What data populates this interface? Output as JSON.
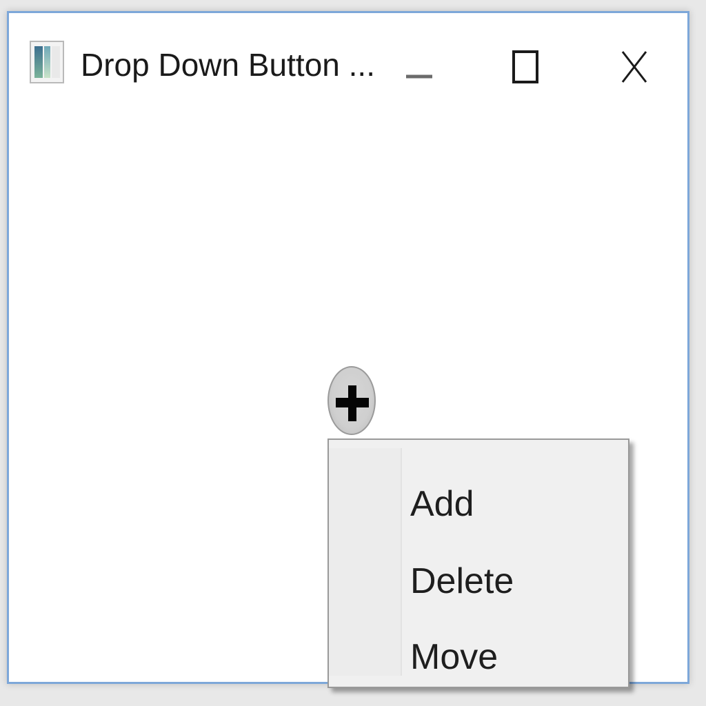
{
  "window": {
    "title": "Drop Down Button ..."
  },
  "icons": {
    "app": "app-window-icon",
    "minimize": "minimize-icon",
    "maximize": "maximize-icon",
    "close": "close-icon",
    "dropdown": "plus-icon"
  },
  "menu": {
    "items": [
      {
        "label": "Add"
      },
      {
        "label": "Delete"
      },
      {
        "label": "Move"
      }
    ]
  }
}
